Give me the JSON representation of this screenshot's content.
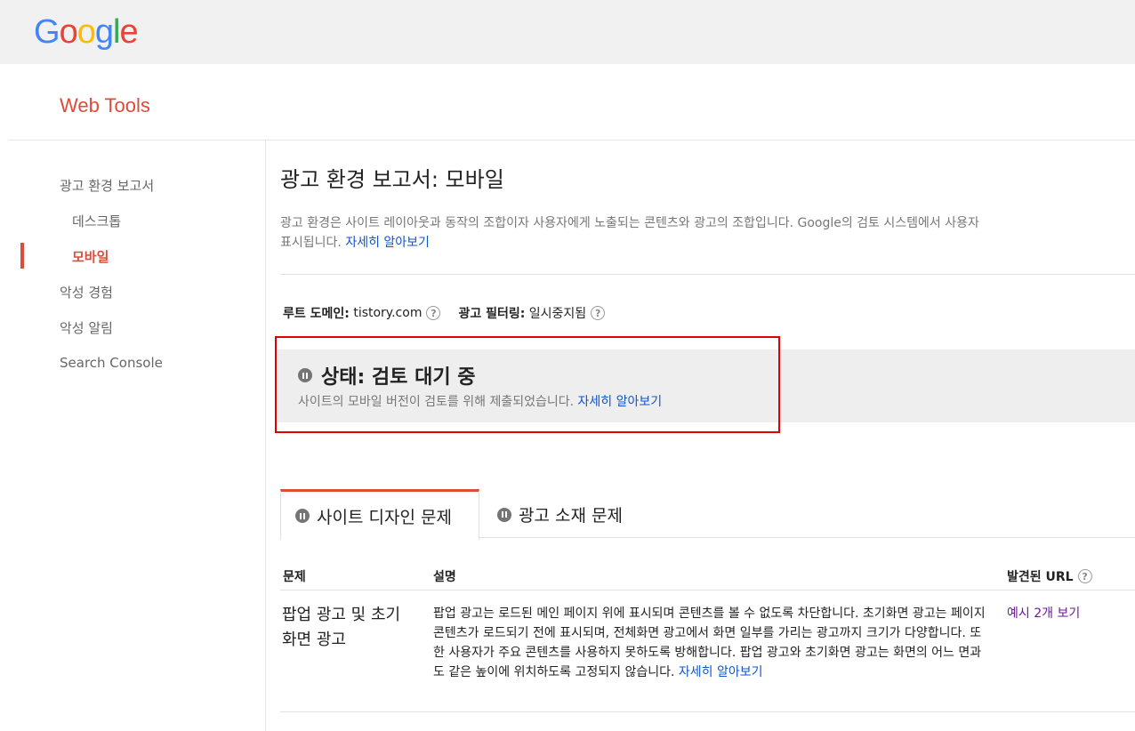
{
  "brand": {
    "logo_letters": [
      "G",
      "o",
      "o",
      "g",
      "l",
      "e"
    ],
    "product": "Web Tools"
  },
  "sidebar": {
    "items": [
      {
        "label": "광고 환경 보고서"
      },
      {
        "label": "데스크톱"
      },
      {
        "label": "모바일",
        "active": true
      },
      {
        "label": "악성 경험"
      },
      {
        "label": "악성 알림"
      },
      {
        "label": "Search Console"
      }
    ]
  },
  "main": {
    "title": "광고 환경 보고서: 모바일",
    "description_line1": "광고 환경은 사이트 레이아웃과 동작의 조합이자 사용자에게 노출되는 콘텐츠와 광고의 조합입니다. Google의 검토 시스템에서 사용자",
    "description_line2": "표시됩니다.",
    "learn_more": "자세히 알아보기",
    "root_domain_label": "루트 도메인:",
    "root_domain_value": "tistory.com",
    "ad_filtering_label": "광고 필터링:",
    "ad_filtering_value": "일시중지됨",
    "help_glyph": "?"
  },
  "status": {
    "title": "상태: 검토 대기 중",
    "description": "사이트의 모바일 버전이 검토를 위해 제출되었습니다.",
    "learn_more": "자세히 알아보기"
  },
  "tabs": [
    {
      "label": "사이트 디자인 문제",
      "active": true
    },
    {
      "label": "광고 소재 문제",
      "active": false
    }
  ],
  "table": {
    "headers": {
      "problem": "문제",
      "description": "설명",
      "found_urls": "발견된 URL"
    },
    "rows": [
      {
        "problem": "팝업 광고 및 초기화면 광고",
        "description": "팝업 광고는 로드된 메인 페이지 위에 표시되며 콘텐츠를 볼 수 없도록 차단합니다. 초기화면 광고는 페이지 콘텐츠가 로드되기 전에 표시되며, 전체화면 광고에서 화면 일부를 가리는 광고까지 크기가 다양합니다. 또한 사용자가 주요 콘텐츠를 사용하지 못하도록 방해합니다. 팝업 광고와 초기화면 광고는 화면의 어느 면과도 같은 높이에 위치하도록 고정되지 않습니다.",
        "learn_more": "자세히 알아보기",
        "url_link": "예시 2개 보기"
      }
    ]
  },
  "colors": {
    "accent": "#dd4b39",
    "link": "#1155cc",
    "outline": "#e00000",
    "visited_link": "#6a1b9a"
  }
}
